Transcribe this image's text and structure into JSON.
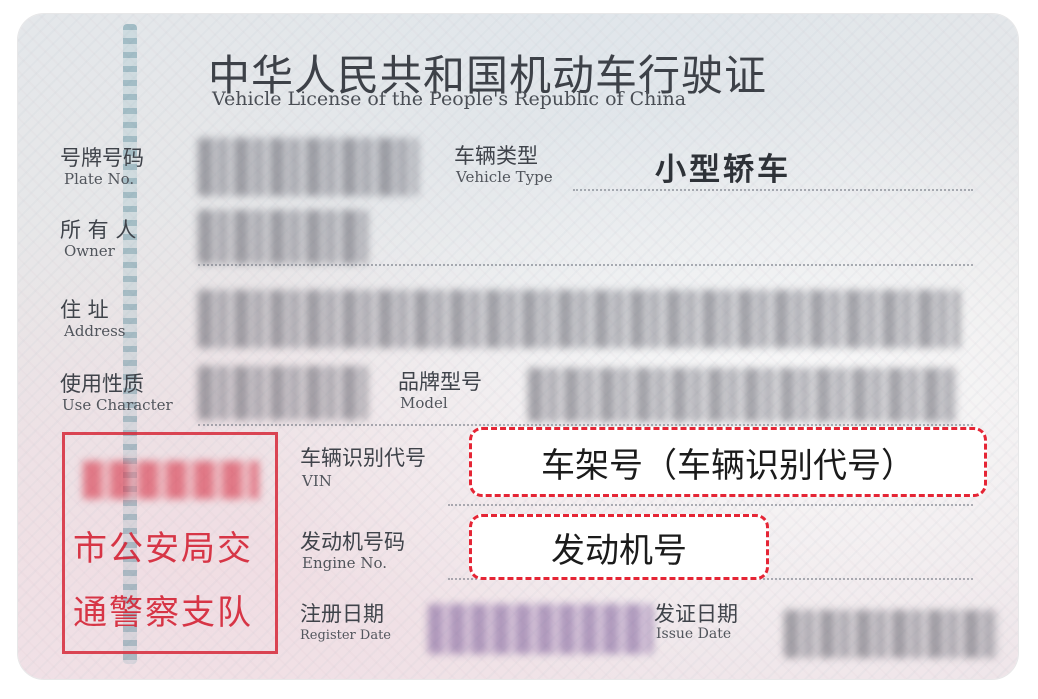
{
  "header": {
    "title_cn": "中华人民共和国机动车行驶证",
    "title_en": "Vehicle License of the People's Republic of China"
  },
  "fields": {
    "plate": {
      "label_cn": "号牌号码",
      "label_en": "Plate No."
    },
    "vehicle_type": {
      "label_cn": "车辆类型",
      "label_en": "Vehicle Type",
      "value": "小型轿车"
    },
    "owner": {
      "label_cn": "所 有 人",
      "label_en": "Owner"
    },
    "address": {
      "label_cn": "住    址",
      "label_en": "Address"
    },
    "use_character": {
      "label_cn": "使用性质",
      "label_en": "Use Character"
    },
    "model": {
      "label_cn": "品牌型号",
      "label_en": "Model"
    },
    "vin": {
      "label_cn": "车辆识别代号",
      "label_en": "VIN"
    },
    "engine": {
      "label_cn": "发动机号码",
      "label_en": "Engine No."
    },
    "register_date": {
      "label_cn": "注册日期",
      "label_en": "Register Date"
    },
    "issue_date": {
      "label_cn": "发证日期",
      "label_en": "Issue Date"
    }
  },
  "seal": {
    "line2": "市公安局交",
    "line3": "通警察支队"
  },
  "callouts": {
    "vin": "车架号（车辆识别代号）",
    "engine": "发动机号"
  },
  "colors": {
    "callout_border": "#e52535",
    "seal_red": "#d42234"
  }
}
